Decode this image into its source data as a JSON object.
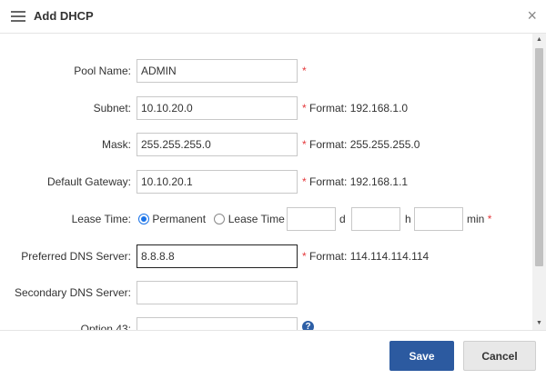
{
  "dialog": {
    "title": "Add DHCP",
    "close_symbol": "×",
    "icons": {
      "menu": "hamburger-menu-icon",
      "close": "close-icon",
      "help": "question-circle-icon"
    },
    "accent_color": "#2c5aa0"
  },
  "form": {
    "required_mark": "*",
    "pool_name": {
      "label": "Pool Name:",
      "value": "ADMIN",
      "hint": ""
    },
    "subnet": {
      "label": "Subnet:",
      "value": "10.10.20.0",
      "hint": "Format: 192.168.1.0"
    },
    "mask": {
      "label": "Mask:",
      "value": "255.255.255.0",
      "hint": "Format: 255.255.255.0"
    },
    "gateway": {
      "label": "Default Gateway:",
      "value": "10.10.20.1",
      "hint": "Format: 192.168.1.1"
    },
    "lease": {
      "label": "Lease Time:",
      "options": [
        "Permanent",
        "Lease Time"
      ],
      "selected": "Permanent",
      "days_value": "",
      "days_unit": "d",
      "hours_value": "",
      "hours_unit": "h",
      "minutes_value": "",
      "minutes_unit": "min"
    },
    "preferred_dns": {
      "label": "Preferred DNS Server:",
      "value": "8.8.8.8",
      "hint": "Format: 114.114.114.114"
    },
    "secondary_dns": {
      "label": "Secondary DNS Server:",
      "value": ""
    },
    "option43": {
      "label": "Option 43:",
      "value": "",
      "help_symbol": "?"
    }
  },
  "footer": {
    "save_label": "Save",
    "cancel_label": "Cancel"
  }
}
